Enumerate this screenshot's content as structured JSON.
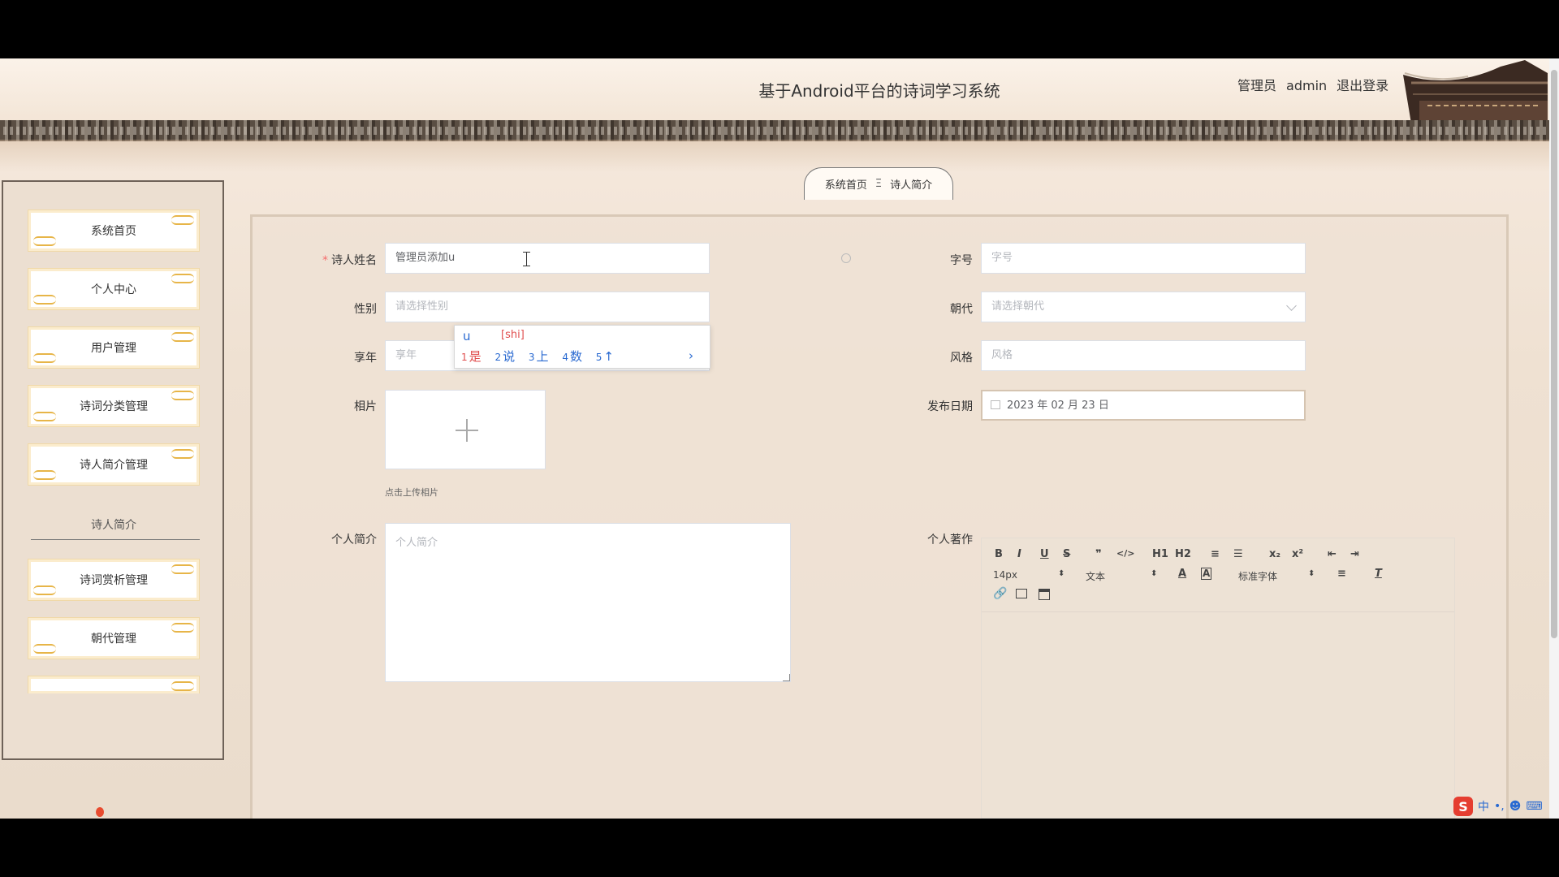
{
  "header": {
    "title": "基于Android平台的诗词学习系统",
    "user_role": "管理员",
    "user_name": "admin",
    "logout": "退出登录"
  },
  "sidebar": {
    "items": [
      {
        "label": "系统首页"
      },
      {
        "label": "个人中心"
      },
      {
        "label": "用户管理"
      },
      {
        "label": "诗词分类管理"
      },
      {
        "label": "诗人简介管理"
      },
      {
        "label": "诗词赏析管理"
      },
      {
        "label": "朝代管理"
      }
    ],
    "section_label": "诗人简介"
  },
  "breadcrumb": {
    "home": "系统首页",
    "separator": "Ξ",
    "current": "诗人简介"
  },
  "form": {
    "poet_name": {
      "label": "诗人姓名",
      "value": "管理员添加u"
    },
    "gender": {
      "label": "性别",
      "placeholder": "请选择性别"
    },
    "age": {
      "label": "享年",
      "placeholder": "享年"
    },
    "photo": {
      "label": "相片",
      "tip": "点击上传相片"
    },
    "intro": {
      "label": "个人简介",
      "placeholder": "个人简介"
    },
    "courtesy_name": {
      "label": "字号",
      "placeholder": "字号"
    },
    "dynasty": {
      "label": "朝代",
      "placeholder": "请选择朝代"
    },
    "style": {
      "label": "风格",
      "placeholder": "风格"
    },
    "publish_date": {
      "label": "发布日期",
      "value": "2023 年 02 月 23 日"
    },
    "works": {
      "label": "个人著作"
    }
  },
  "editor": {
    "toolbar_row1": [
      "B",
      "I",
      "U",
      "S",
      "❞",
      "</>",
      "H1",
      "H2",
      "≡",
      "☰",
      "x₂",
      "x²",
      "⇤",
      "⇥"
    ],
    "font_size": "14px",
    "text_type": "文本",
    "font_family": "标准字体"
  },
  "ime": {
    "composition": "u",
    "pinyin": "[shi]",
    "candidates": [
      {
        "n": "1",
        "text": "是"
      },
      {
        "n": "2",
        "text": "说"
      },
      {
        "n": "3",
        "text": "上"
      },
      {
        "n": "4",
        "text": "数"
      },
      {
        "n": "5",
        "text": "↑"
      }
    ],
    "next": "›"
  },
  "taskbar": {
    "ime_logo": "S",
    "lang": "中"
  }
}
